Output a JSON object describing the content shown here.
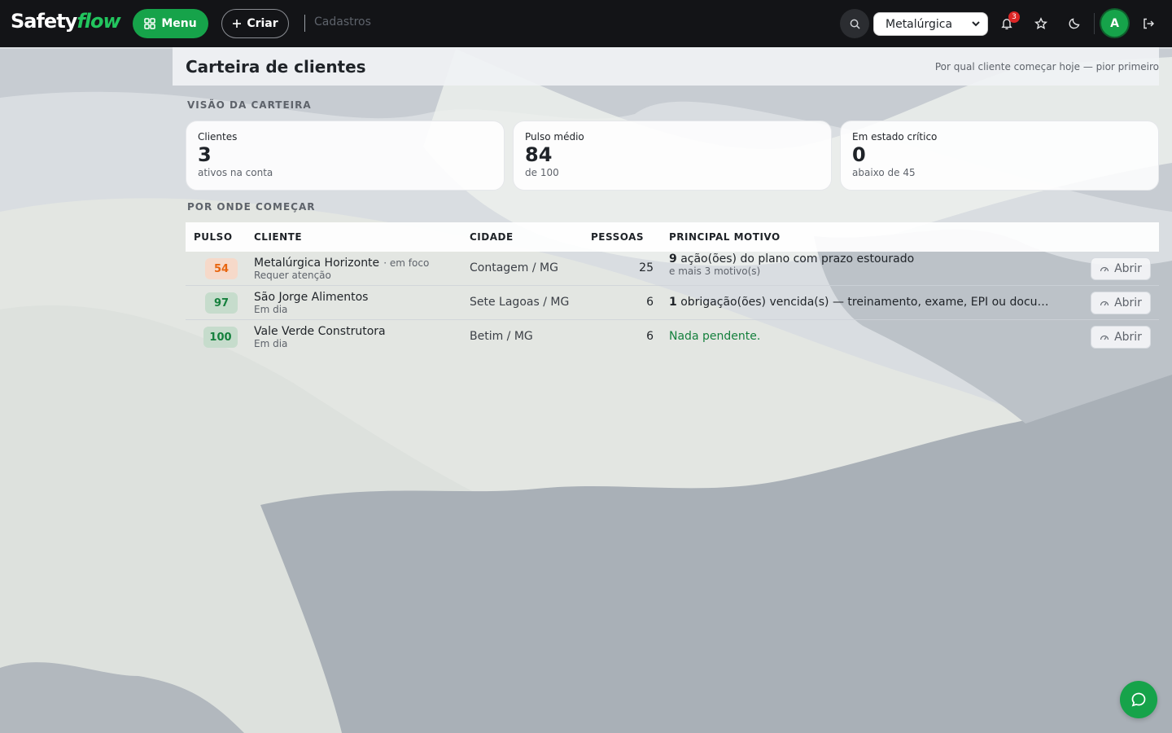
{
  "brand": {
    "logo_part1": "Safety",
    "logo_part2": "flow"
  },
  "topbar": {
    "menu_label": "Menu",
    "create_label": "Criar",
    "breadcrumb": "Cadastros",
    "company_selected": "Metalúrgica",
    "notifications_count": "3",
    "avatar_initial": "A"
  },
  "page": {
    "title": "Carteira de clientes",
    "subtitle": "Por qual cliente começar hoje — pior primeiro"
  },
  "overview": {
    "label": "VISÃO DA CARTEIRA",
    "cards": [
      {
        "title": "Clientes",
        "value": "3",
        "sub": "ativos na conta"
      },
      {
        "title": "Pulso médio",
        "value": "84",
        "sub": "de 100"
      },
      {
        "title": "Em estado crítico",
        "value": "0",
        "sub": "abaixo de 45"
      }
    ]
  },
  "start": {
    "label": "POR ONDE COMEÇAR",
    "headers": {
      "pulse": "PULSO",
      "client": "CLIENTE",
      "city": "CIDADE",
      "people": "PESSOAS",
      "motive": "PRINCIPAL MOTIVO"
    },
    "rows": [
      {
        "pulse": "54",
        "pulse_level": "warn",
        "name": "Metalúrgica Horizonte",
        "focus": "· em foco",
        "status": "Requer atenção",
        "city": "Contagem / MG",
        "people": "25",
        "motive_count": "9",
        "motive_text": " ação(ões) do plano com prazo estourado",
        "motive_sub": "e mais 3 motivo(s)",
        "open_label": "Abrir"
      },
      {
        "pulse": "97",
        "pulse_level": "ok",
        "name": "São Jorge Alimentos",
        "focus": "",
        "status": "Em dia",
        "city": "Sete Lagoas / MG",
        "people": "6",
        "motive_count": "1",
        "motive_text": " obrigação(ões) vencida(s) — treinamento, exame, EPI ou document...",
        "motive_sub": "",
        "open_label": "Abrir"
      },
      {
        "pulse": "100",
        "pulse_level": "ok",
        "name": "Vale Verde Construtora",
        "focus": "",
        "status": "Em dia",
        "city": "Betim / MG",
        "people": "6",
        "motive_count": "",
        "motive_text": "Nada pendente.",
        "motive_sub": "",
        "open_label": "Abrir"
      }
    ]
  },
  "colors": {
    "brand_green": "#16a34a",
    "warn": "#e8650f",
    "ok": "#15803d",
    "topbar": "#131417",
    "badge": "#dc2626"
  }
}
